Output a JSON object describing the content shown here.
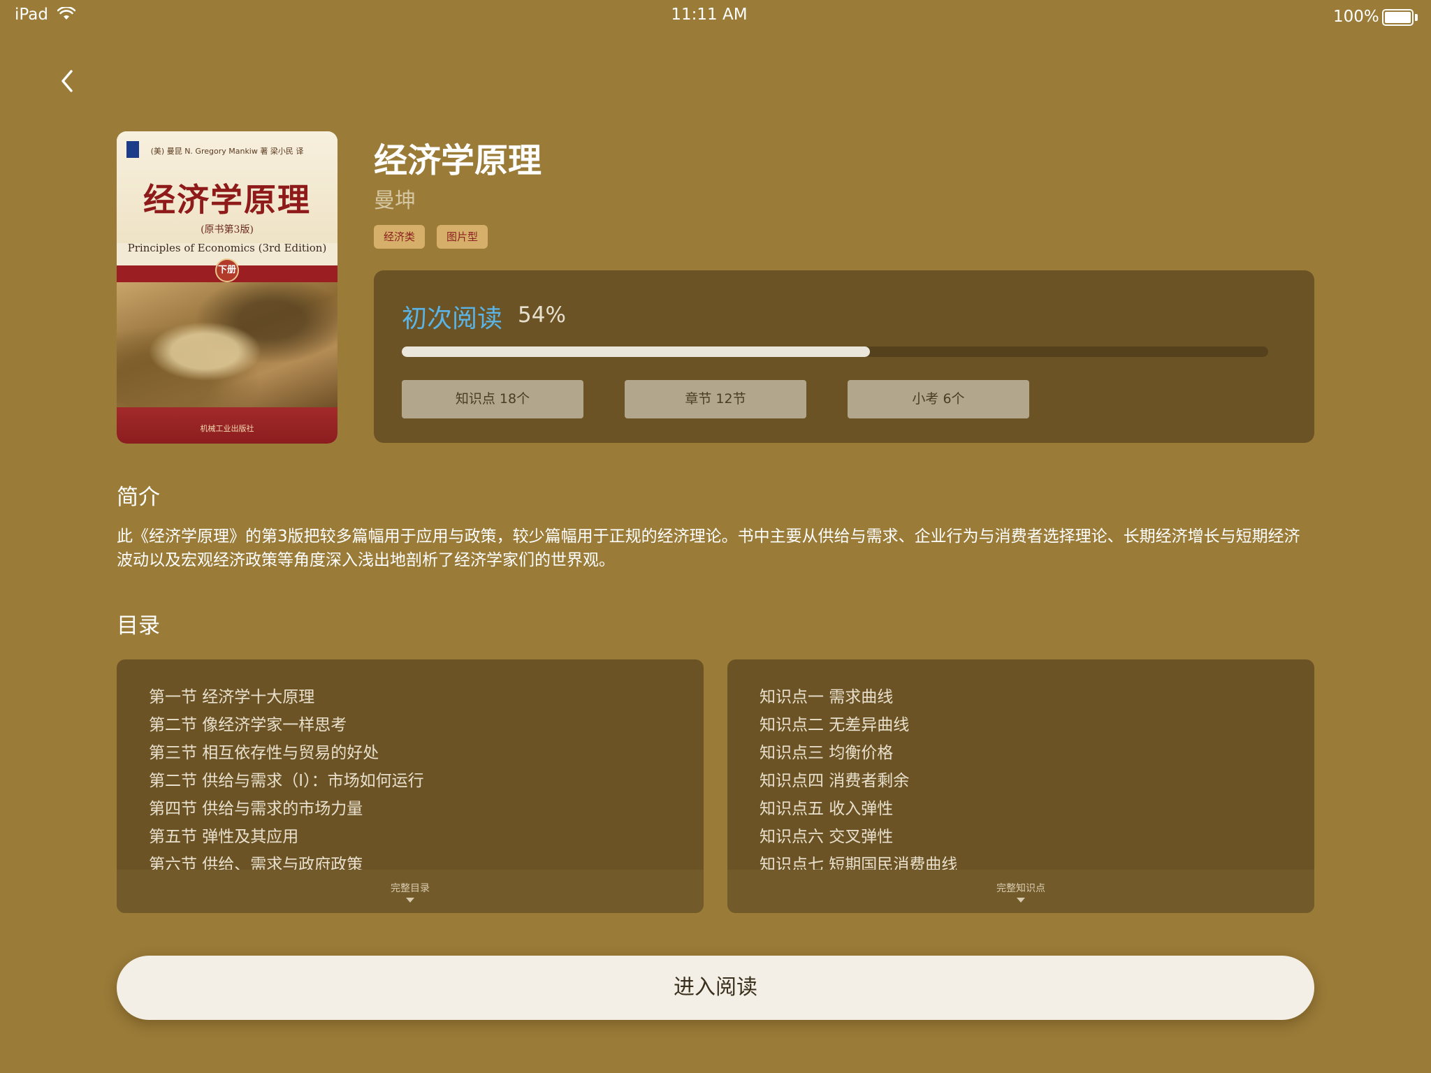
{
  "status_bar": {
    "device": "iPad",
    "time": "11:11 AM",
    "battery": "100%"
  },
  "book": {
    "title": "经济学原理",
    "author": "曼坤",
    "tags": [
      "经济类",
      "图片型"
    ],
    "cover": {
      "author_line": "(美) 曼昆 N. Gregory Mankiw 著  梁小民 译",
      "title": "经济学原理",
      "edition": "(原书第3版)",
      "english_title": "Principles of Economics (3rd Edition)",
      "volume": "下册",
      "publisher": "机械工业出版社"
    }
  },
  "progress": {
    "label": "初次阅读",
    "percent_text": "54%",
    "percent": 0.54,
    "stats": [
      {
        "label": "知识点  18个"
      },
      {
        "label": "章节  12节"
      },
      {
        "label": "小考  6个"
      }
    ]
  },
  "intro": {
    "heading": "简介",
    "text": "此《经济学原理》的第3版把较多篇幅用于应用与政策，较少篇幅用于正规的经济理论。书中主要从供给与需求、企业行为与消费者选择理论、长期经济增长与短期经济波动以及宏观经济政策等角度深入浅出地剖析了经济学家们的世界观。"
  },
  "toc": {
    "heading": "目录",
    "chapters": [
      "第一节 经济学十大原理",
      "第二节 像经济学家一样思考",
      "第三节 相互依存性与贸易的好处",
      "第二节 供给与需求（I）：市场如何运行",
      "第四节 供给与需求的市场力量",
      "第五节 弹性及其应用",
      "第六节 供给、需求与政府政策"
    ],
    "chapters_more": "完整目录",
    "points": [
      "知识点一 需求曲线",
      "知识点二 无差异曲线",
      "知识点三 均衡价格",
      "知识点四 消费者剩余",
      "知识点五 收入弹性",
      "知识点六 交叉弹性",
      "知识点七 短期国民消费曲线"
    ],
    "points_more": "完整知识点"
  },
  "actions": {
    "enter": "进入阅读"
  },
  "colors": {
    "background": "#9a7b38",
    "panel": "#6b5325",
    "accent_blue": "#5ab4e6",
    "tag_bg": "#d6b06a",
    "tag_text": "#8a1f1f"
  }
}
